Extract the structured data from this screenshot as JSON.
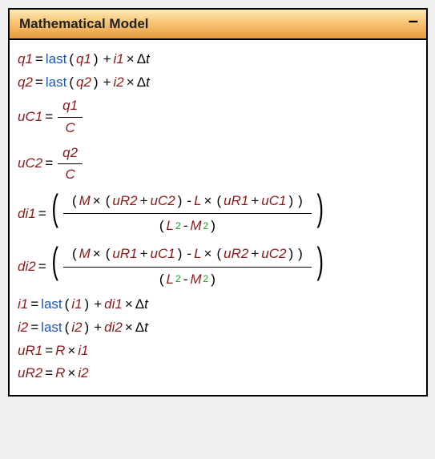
{
  "window": {
    "title": "Mathematical Model",
    "minimize": "–"
  },
  "vars": {
    "q1": "q1",
    "q2": "q2",
    "uC1": "uC1",
    "uC2": "uC2",
    "di1": "di1",
    "di2": "di2",
    "i1": "i1",
    "i2": "i2",
    "uR1": "uR1",
    "uR2": "uR2",
    "C": "C",
    "M": "M",
    "L": "L",
    "R": "R"
  },
  "fn": {
    "last": "last"
  },
  "sym": {
    "eq": "=",
    "plus": "+",
    "minus": "-",
    "times": "×",
    "lp": "(",
    "rp": ")",
    "Delta": "Δ",
    "t": "t",
    "two": "2"
  }
}
